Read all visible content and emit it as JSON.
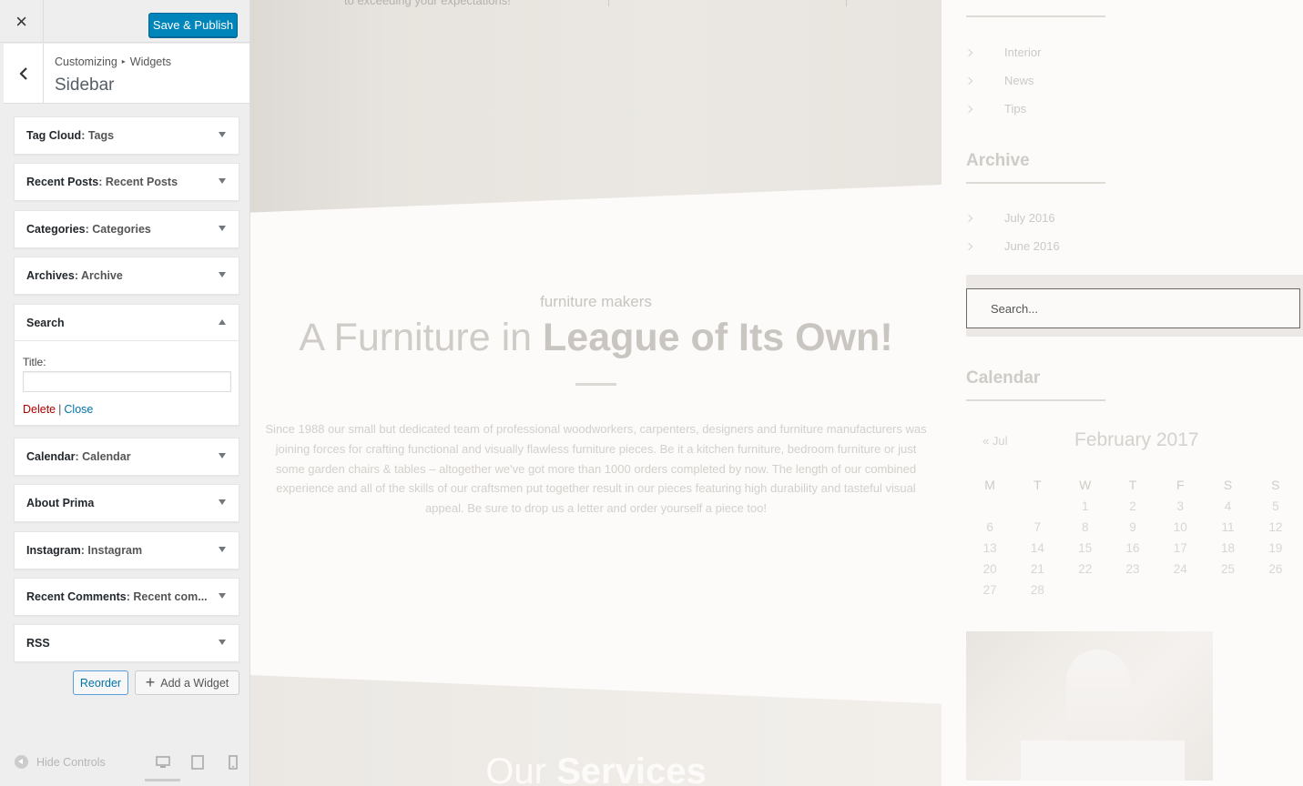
{
  "customizer": {
    "close_label": "×",
    "publish_label": "Save & Publish",
    "breadcrumb": {
      "root": "Customizing",
      "separator": "▸",
      "current": "Widgets"
    },
    "panel_title": "Sidebar",
    "widgets": [
      {
        "type": "Tag Cloud",
        "title": ": Tags"
      },
      {
        "type": "Recent Posts",
        "title": ": Recent Posts"
      },
      {
        "type": "Categories",
        "title": ": Categories"
      },
      {
        "type": "Archives",
        "title": ": Archive"
      },
      {
        "type": "Search",
        "title": ""
      },
      {
        "type": "Calendar",
        "title": ": Calendar"
      },
      {
        "type": "About Prima",
        "title": ""
      },
      {
        "type": "Instagram",
        "title": ": Instagram"
      },
      {
        "type": "Recent Comments",
        "title": ": Recent com..."
      },
      {
        "type": "RSS",
        "title": ""
      }
    ],
    "search_form": {
      "title_label": "Title:",
      "title_value": "",
      "delete_label": "Delete",
      "separator": "|",
      "close_label": "Close"
    },
    "reorder_label": "Reorder",
    "add_widget_label": "Add a Widget",
    "hide_controls_label": "Hide Controls"
  },
  "preview": {
    "hero_tagline": "to exceeding your expectations!",
    "pre_title": "furniture makers",
    "heading_light": "A Furniture in ",
    "heading_bold": "League of Its Own!",
    "intro_text": "Since 1988 our small but dedicated team of professional woodworkers, carpenters, designers and furniture manufacturers was joining forces for crafting functional and visually flawless furniture pieces. Be it a kitchen furniture, bedroom furniture or just some garden chairs & tables – altogether we've got more than 1000 orders completed by now. The length of our combined experience and all of the skills of our craftsmen put together result in our pieces featuring high durability and tasteful visual appeal. Be sure to drop us a letter and order yourself a piece too!",
    "services_light": "Our ",
    "services_bold": "Services",
    "categories": [
      "Interior",
      "News",
      "Tips"
    ],
    "archive_heading": "Archive",
    "archives": [
      "July 2016",
      "June 2016"
    ],
    "search_placeholder": "Search...",
    "calendar_heading": "Calendar",
    "calendar": {
      "prev": "« Jul",
      "month": "February 2017",
      "weekdays": [
        "M",
        "T",
        "W",
        "T",
        "F",
        "S",
        "S"
      ],
      "weeks": [
        [
          "",
          "",
          "1",
          "2",
          "3",
          "4",
          "5"
        ],
        [
          "6",
          "7",
          "8",
          "9",
          "10",
          "11",
          "12"
        ],
        [
          "13",
          "14",
          "15",
          "16",
          "17",
          "18",
          "19"
        ],
        [
          "20",
          "21",
          "22",
          "23",
          "24",
          "25",
          "26"
        ],
        [
          "27",
          "28",
          "",
          "",
          "",
          "",
          ""
        ]
      ]
    }
  }
}
